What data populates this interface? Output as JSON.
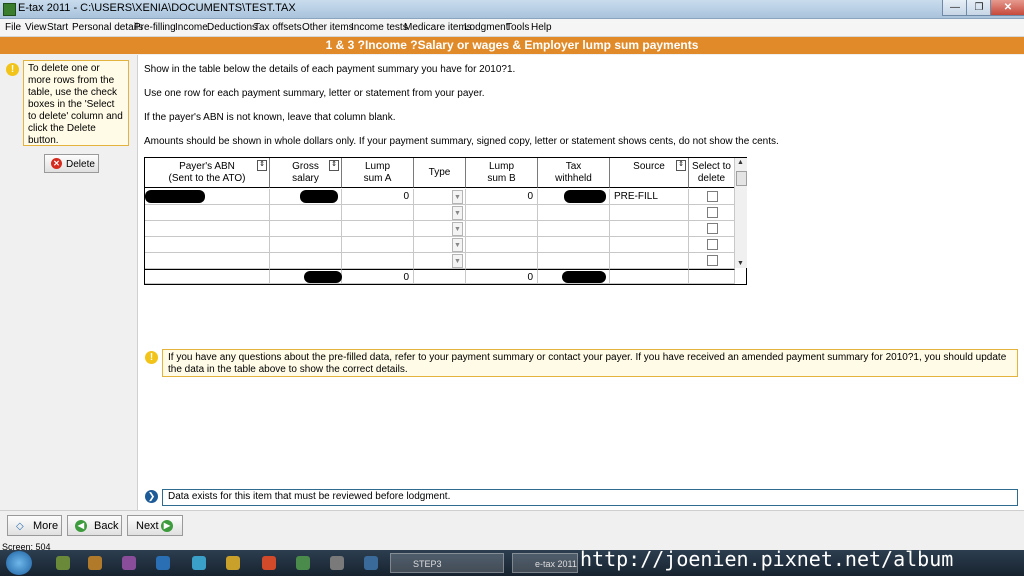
{
  "window": {
    "title": "E-tax 2011 - C:\\USERS\\XENIA\\DOCUMENTS\\TEST.TAX",
    "minimize": "—",
    "maximize": "❐",
    "close": "✕"
  },
  "menu": [
    "File",
    "View",
    "Start",
    "Personal details",
    "Pre-filling",
    "Income",
    "Deductions",
    "Tax offsets",
    "Other items",
    "Income tests",
    "Medicare items",
    "Lodgment",
    "Tools",
    "Help"
  ],
  "section_title": "1 & 3 ?Income ?Salary or wages & Employer lump sum payments",
  "sidebar": {
    "tip_icon": "!",
    "tip_text": "To delete one or more rows from the table, use the check boxes in the 'Select to delete' column and click the Delete button.",
    "delete_label": "Delete",
    "delete_icon": "✕"
  },
  "instructions": [
    "Show in the table below the details of each payment summary you have for 2010?1.",
    "Use one row for each payment summary, letter or statement from your payer.",
    "If the payer's ABN is not known, leave that column blank.",
    "Amounts should be shown in whole dollars only. If your payment summary, signed copy, letter or statement shows cents, do not show the cents."
  ],
  "table": {
    "columns": {
      "abn_line1": "Payer's ABN",
      "abn_line2": "(Sent to the ATO)",
      "gross_line1": "Gross",
      "gross_line2": "salary",
      "lumpa_line1": "Lump",
      "lumpa_line2": "sum A",
      "type": "Type",
      "lumpb_line1": "Lump",
      "lumpb_line2": "sum B",
      "tax_line1": "Tax",
      "tax_line2": "withheld",
      "source": "Source",
      "select_line1": "Select to",
      "select_line2": "delete"
    },
    "row1": {
      "lump_a": "0",
      "lump_b": "0",
      "source": "PRE-FILL"
    },
    "totals": {
      "lump_a": "0",
      "lump_b": "0"
    }
  },
  "info": {
    "icon": "!",
    "text": "If you have any questions about the pre-filled data, refer to your payment summary or contact your payer. If you have received an amended payment summary for 2010?1, you should update the data in the table above to show the correct details."
  },
  "status": {
    "text": "Data exists for this item that must be reviewed before lodgment."
  },
  "nav": {
    "more": "More",
    "back": "Back",
    "next": "Next"
  },
  "screen_label": "Screen: 504",
  "taskbar": {
    "task1": "STEP3",
    "task2": "e-tax 2011"
  },
  "watermark": "http://joenien.pixnet.net/album"
}
